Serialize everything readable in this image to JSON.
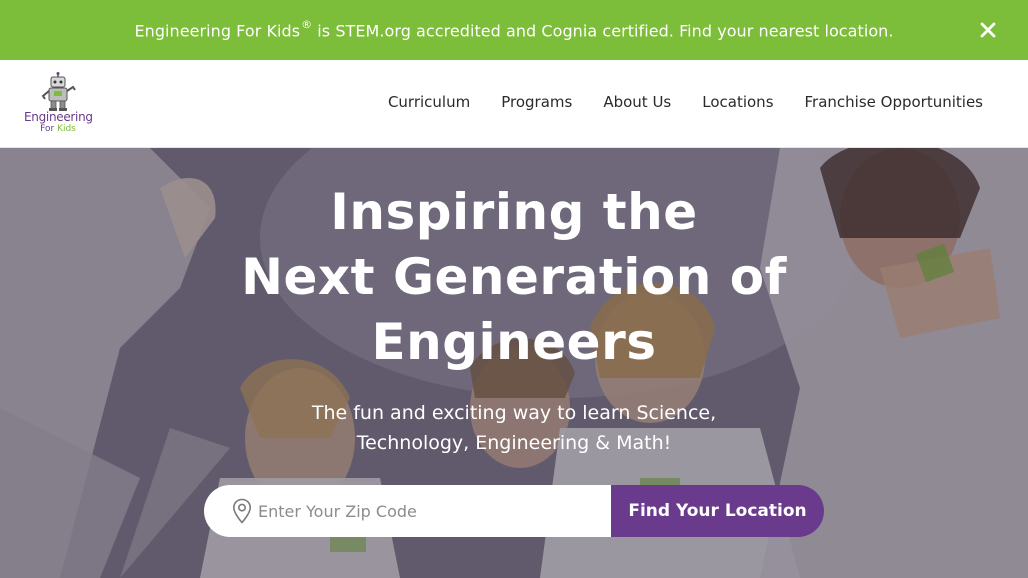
{
  "announcement": {
    "brand": "Engineering For Kids",
    "registered_mark": "®",
    "message": " is STEM.org accredited and Cognia certified. Find your nearest location.",
    "close_icon": "close-icon"
  },
  "logo": {
    "line1": "Engineering",
    "line2_a": "For ",
    "line2_b": "Kids",
    "icon": "robot-mascot"
  },
  "nav": {
    "items": [
      {
        "label": "Curriculum"
      },
      {
        "label": "Programs"
      },
      {
        "label": "About Us"
      },
      {
        "label": "Locations"
      },
      {
        "label": "Franchise Opportunities"
      }
    ]
  },
  "hero": {
    "title_lines": [
      "Inspiring the",
      "Next Generation of",
      "Engineers"
    ],
    "subtitle_lines": [
      "The fun and exciting way to learn Science,",
      "Technology, Engineering & Math!"
    ],
    "search": {
      "placeholder": "Enter Your Zip Code",
      "value": "",
      "icon": "location-pin-icon",
      "button_label": "Find Your Location"
    }
  },
  "colors": {
    "accent_green": "#7cbd3a",
    "brand_purple": "#6a3a8c"
  }
}
